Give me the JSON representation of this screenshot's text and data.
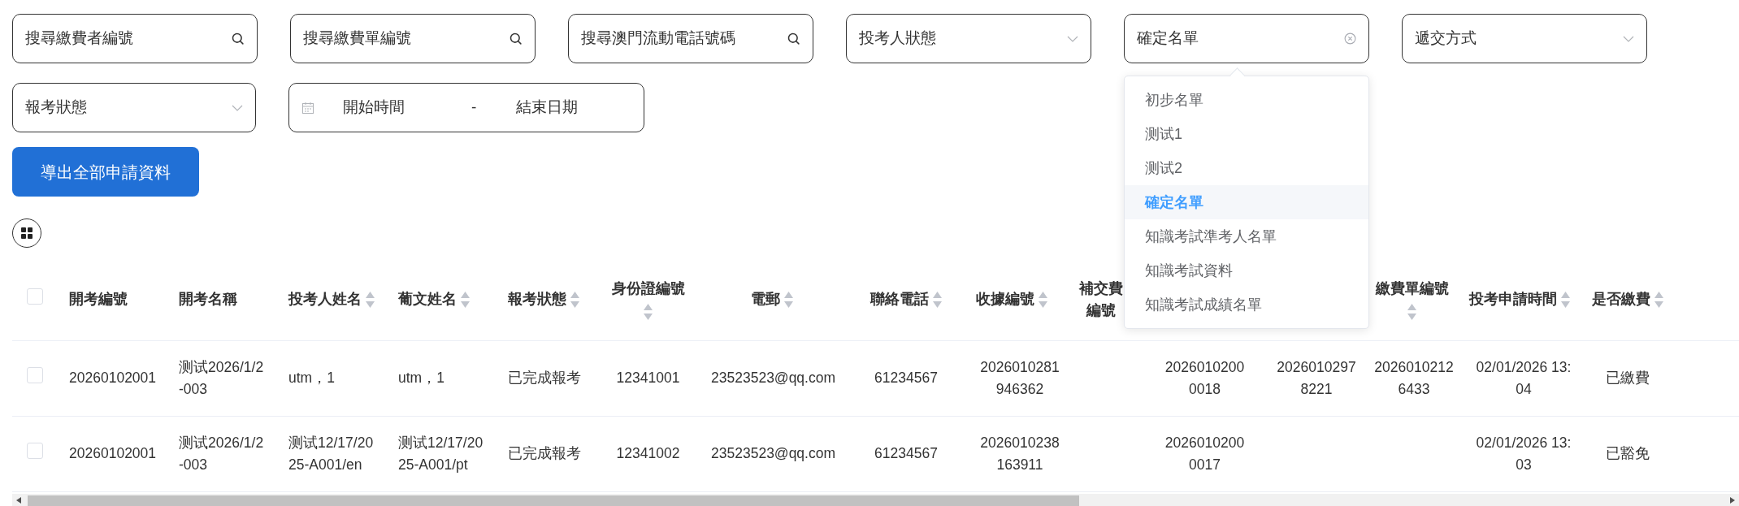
{
  "filters_row_1": [
    {
      "kind": "search",
      "placeholder": "搜尋繳費者編號"
    },
    {
      "kind": "search",
      "placeholder": "搜尋繳費單編號"
    },
    {
      "kind": "search",
      "placeholder": "搜尋澳門流動電話號碼"
    },
    {
      "kind": "select",
      "placeholder": "投考人狀態"
    },
    {
      "kind": "clearable",
      "value": "確定名單",
      "expanded": true,
      "options": [
        {
          "label": "初步名單",
          "selected": false
        },
        {
          "label": "测试1",
          "selected": false
        },
        {
          "label": "测试2",
          "selected": false
        },
        {
          "label": "確定名單",
          "selected": true
        },
        {
          "label": "知識考試準考人名單",
          "selected": false
        },
        {
          "label": "知識考試資料",
          "selected": false
        },
        {
          "label": "知識考試成績名單",
          "selected": false
        }
      ]
    },
    {
      "kind": "select",
      "placeholder": "遞交方式"
    }
  ],
  "filters_row_2": [
    {
      "kind": "select",
      "placeholder": "報考狀態"
    },
    {
      "kind": "daterange",
      "start_placeholder": "開始時間",
      "separator": "-",
      "end_placeholder": "結束日期"
    }
  ],
  "export_button": "導出全部申請資料",
  "table": {
    "header_checked": false,
    "columns": [
      {
        "title": "開考編號"
      },
      {
        "title": "開考名稱"
      },
      {
        "title": "投考人姓名",
        "sortable": true
      },
      {
        "title": "葡文姓名",
        "sortable": true
      },
      {
        "title": "報考狀態",
        "sortable": true
      },
      {
        "title": "身份證編號",
        "sortable": true
      },
      {
        "title": "電郵",
        "sortable": true
      },
      {
        "title": "聯絡電話",
        "sortable": true
      },
      {
        "title": "收據編號",
        "sortable": true
      },
      {
        "title": "補交費編號"
      },
      {},
      {},
      {
        "title": "繳費單編號",
        "sortable": true
      },
      {
        "title": "投考申請時間",
        "sortable": true
      },
      {
        "title": "是否繳費",
        "sortable": true
      }
    ],
    "rows": [
      {
        "checked": false,
        "cells": [
          "20260102001",
          "测试2026/1/2-003",
          "utm，1",
          "utm，1",
          "已完成報考",
          "12341001",
          "23523523@qq.com",
          "61234567",
          "2026010281946362",
          "",
          "20260102000018",
          "20260102978221",
          "20260102126433",
          "02/01/2026 13:04",
          "已繳費"
        ]
      },
      {
        "checked": false,
        "cells": [
          "20260102001",
          "测试2026/1/2-003",
          "测试12/17/2025-A001/en",
          "测试12/17/2025-A001/pt",
          "已完成報考",
          "12341002",
          "23523523@qq.com",
          "61234567",
          "2026010238163911",
          "",
          "20260102000017",
          "",
          "",
          "02/01/2026 13:03",
          "已豁免"
        ]
      }
    ]
  }
}
